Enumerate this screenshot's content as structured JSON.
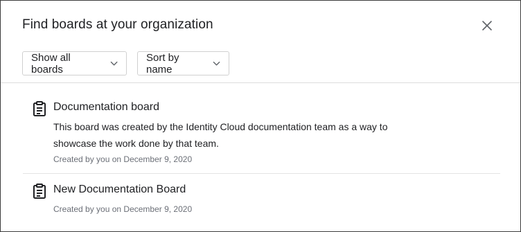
{
  "dialog": {
    "title": "Find boards at your organization",
    "close_icon": "close-icon"
  },
  "toolbar": {
    "filter_label": "Show all boards",
    "sort_label": "Sort by name",
    "chevron_icon": "chevron-down-icon"
  },
  "boards": [
    {
      "icon": "clipboard-icon",
      "name": "Documentation board",
      "description": "This board was created by the Identity Cloud documentation team as a way to showcase the work done by that team.",
      "meta": "Created by you on December 9, 2020"
    },
    {
      "icon": "clipboard-icon",
      "name": "New Documentation Board",
      "description": "",
      "meta": "Created by you on December 9, 2020"
    }
  ],
  "colors": {
    "text": "#202124",
    "secondary_text": "#6b6f77",
    "border": "#d0d0d0"
  }
}
